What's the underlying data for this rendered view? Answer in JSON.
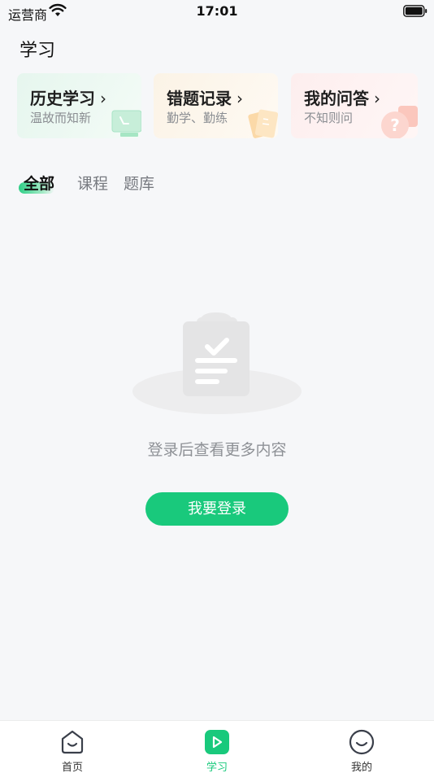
{
  "status_bar": {
    "carrier": "运营商",
    "time": "17:01"
  },
  "page": {
    "title": "学习"
  },
  "cards": [
    {
      "title": "历史学习",
      "arrow": "›",
      "subtitle": "温故而知新"
    },
    {
      "title": "错题记录",
      "arrow": "›",
      "subtitle": "勤学、勤练"
    },
    {
      "title": "我的问答",
      "arrow": "›",
      "subtitle": "不知则问"
    }
  ],
  "tabs": [
    {
      "label": "全部",
      "active": true
    },
    {
      "label": "课程",
      "active": false
    },
    {
      "label": "题库",
      "active": false
    }
  ],
  "empty_state": {
    "icon": "clipboard-check-icon",
    "message": "登录后查看更多内容",
    "login_button": "我要登录"
  },
  "tab_bar": [
    {
      "label": "首页",
      "icon": "home-face-icon"
    },
    {
      "label": "学习",
      "icon": "play-icon",
      "active": true
    },
    {
      "label": "我的",
      "icon": "smile-icon"
    }
  ],
  "colors": {
    "accent": "#19c97c",
    "background": "#f6f7f9"
  }
}
